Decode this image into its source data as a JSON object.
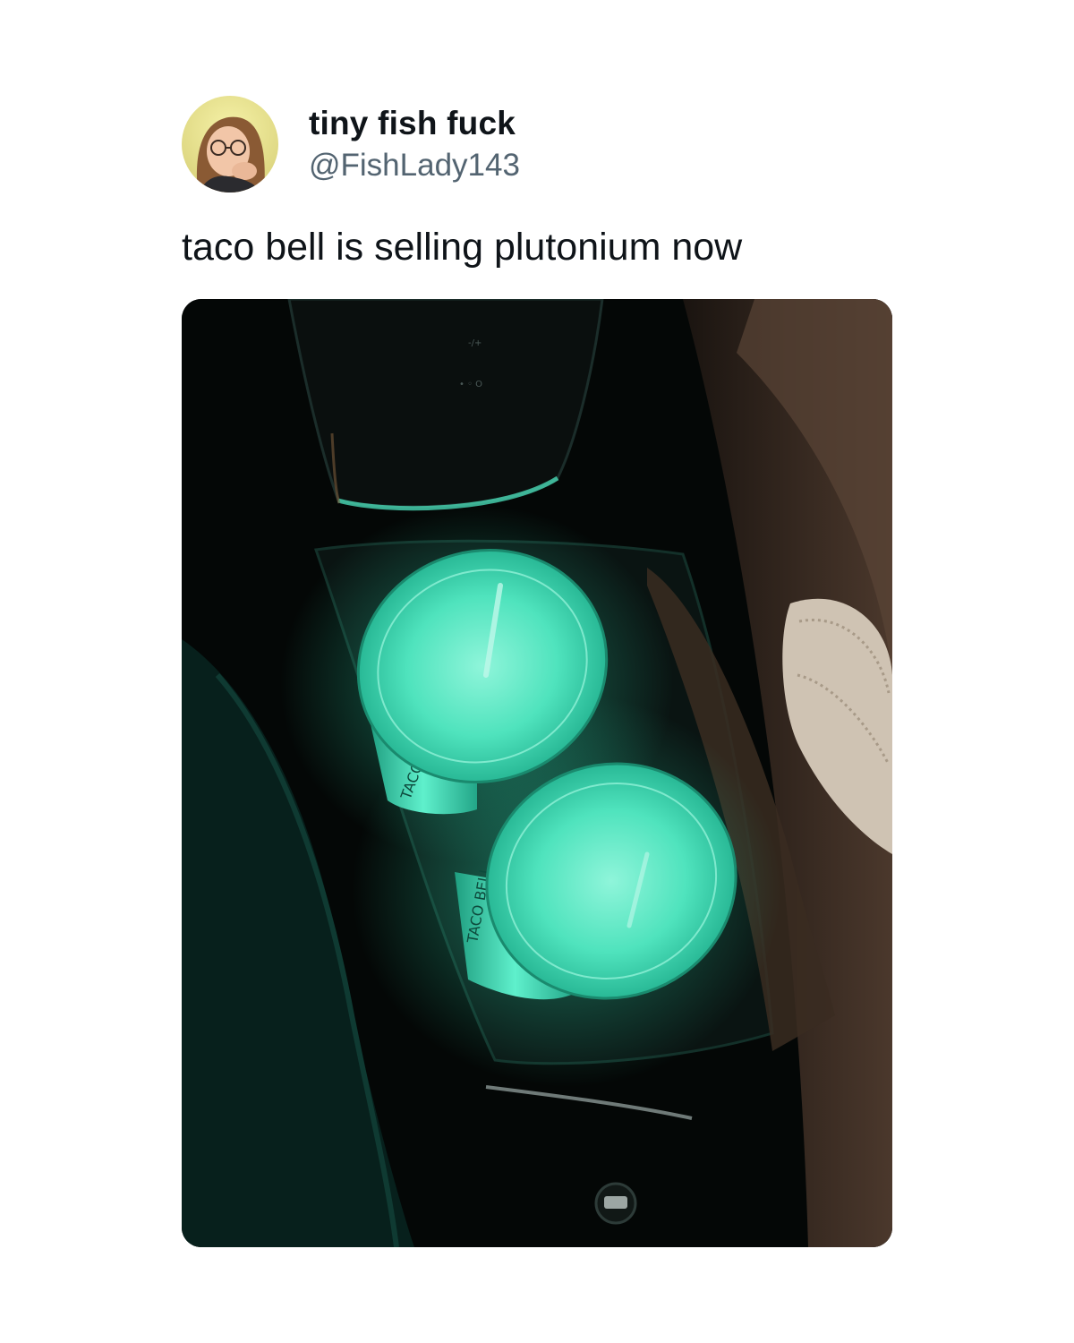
{
  "tweet": {
    "display_name": "tiny fish fuck",
    "handle": "@FishLady143",
    "text": "taco bell is selling plutonium now",
    "avatar_icon": "user-avatar-photo",
    "media_icon": "car-console-glowing-cups-photo"
  },
  "photo": {
    "cup_label_left": "TACO BELL",
    "cup_label_right": "TACO BELL",
    "glow_color": "#3fe0b8",
    "interior_color": "#050807"
  }
}
